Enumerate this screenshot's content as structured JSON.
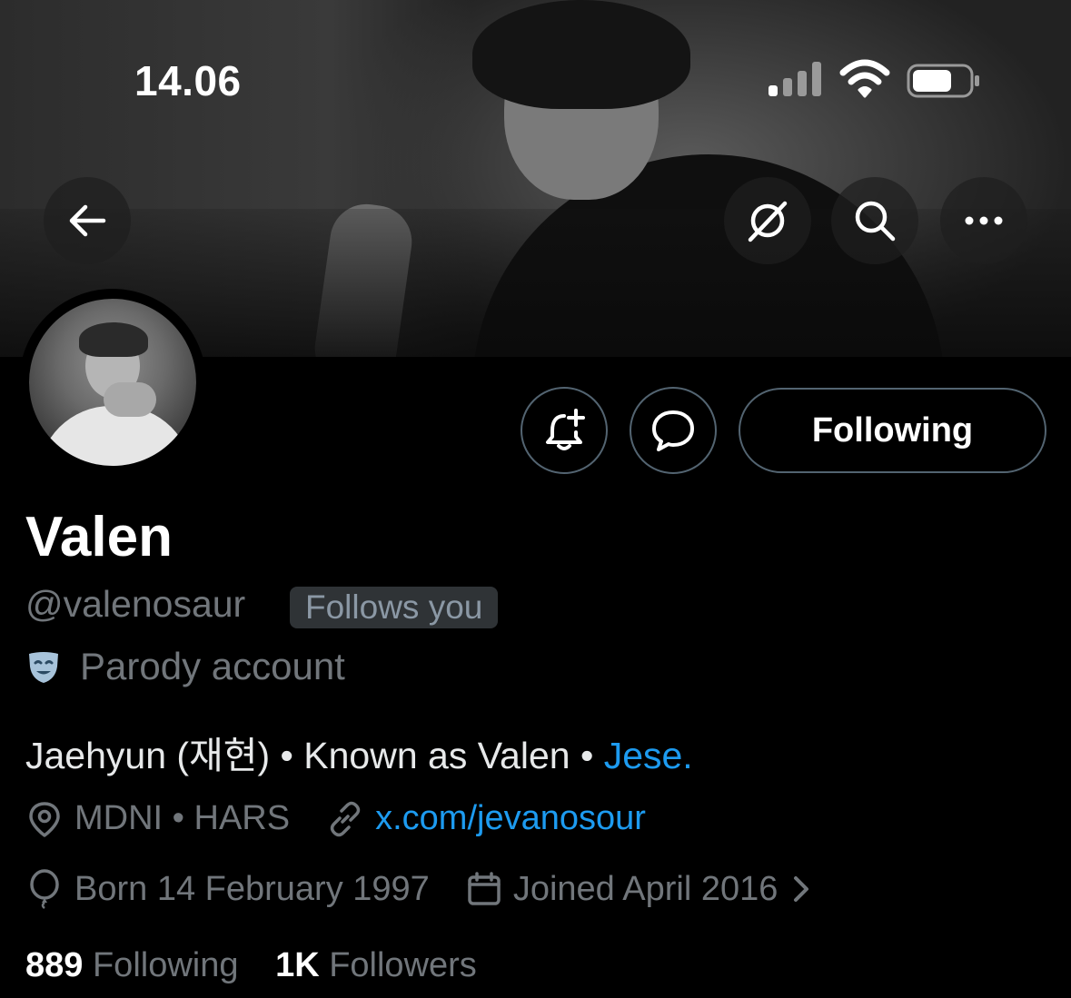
{
  "status_bar": {
    "time": "14.06"
  },
  "header": {
    "back_icon": "arrow-left-icon",
    "grok_icon": "grok-icon",
    "search_icon": "search-icon",
    "more_icon": "more-horizontal-icon"
  },
  "actions": {
    "notify_icon": "bell-plus-icon",
    "message_icon": "chat-bubble-icon",
    "following_label": "Following"
  },
  "profile": {
    "name": "Valen",
    "handle": "@valenosaur",
    "follows_you": "Follows you",
    "parody_label": "Parody account",
    "bio_text": "Jaehyun (재현) • Known as Valen • ",
    "bio_link": "Jese.",
    "location": "MDNI • HARS",
    "website": "x.com/jevanosour",
    "birthday": "Born 14 February 1997",
    "joined": "Joined April 2016",
    "following_count": "889",
    "following_label": "Following",
    "followers_count": "1K",
    "followers_label": "Followers"
  },
  "colors": {
    "link": "#1d9bf0",
    "muted": "#71767b",
    "border": "#536471",
    "background": "#000000"
  }
}
